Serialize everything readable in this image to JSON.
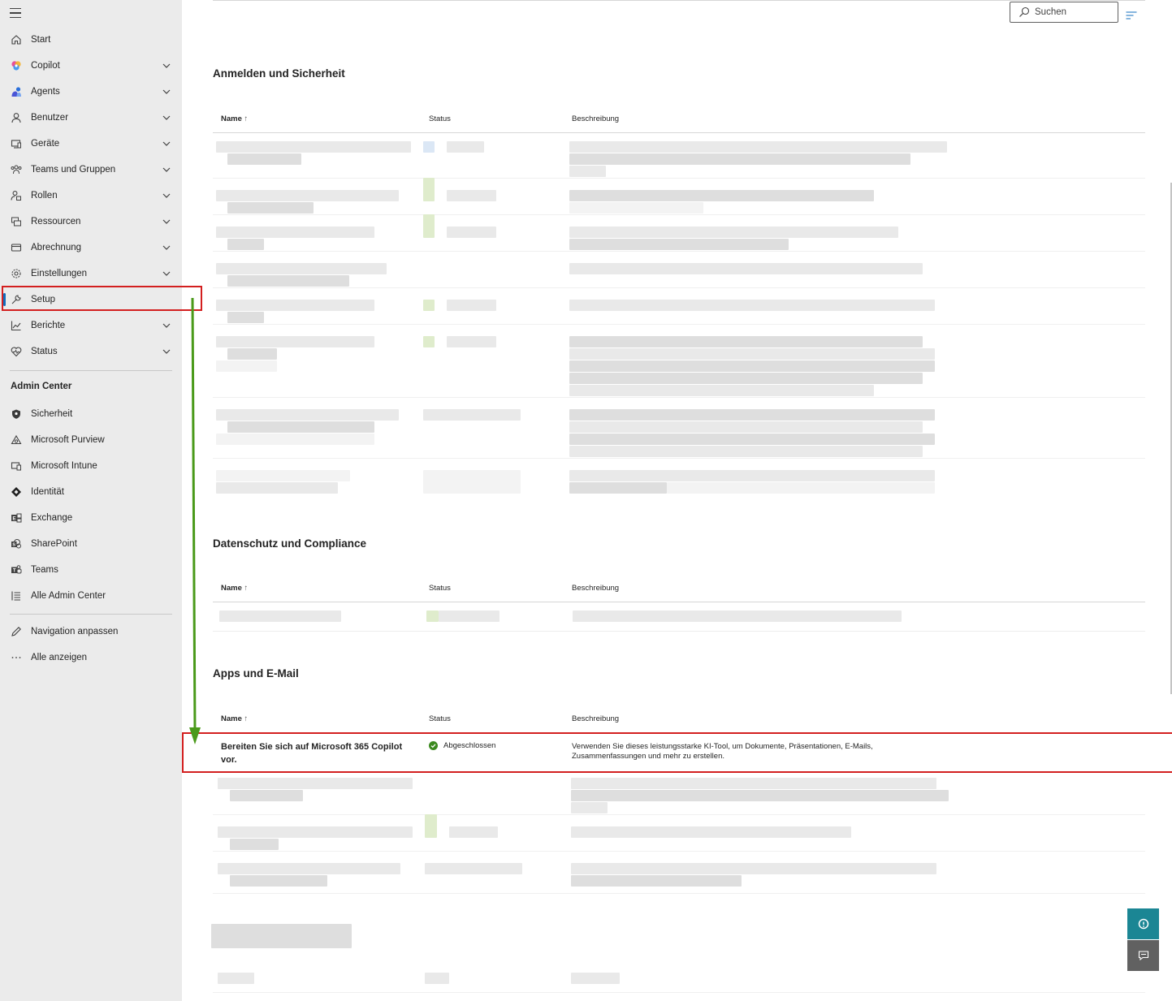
{
  "sidebar": {
    "items": [
      {
        "label": "Start",
        "icon": "home-icon",
        "chevron": false
      },
      {
        "label": "Copilot",
        "icon": "copilot-icon",
        "chevron": true
      },
      {
        "label": "Agents",
        "icon": "agents-icon",
        "chevron": true
      },
      {
        "label": "Benutzer",
        "icon": "user-icon",
        "chevron": true
      },
      {
        "label": "Geräte",
        "icon": "devices-icon",
        "chevron": true
      },
      {
        "label": "Teams und Gruppen",
        "icon": "teams-groups-icon",
        "chevron": true
      },
      {
        "label": "Rollen",
        "icon": "roles-icon",
        "chevron": true
      },
      {
        "label": "Ressourcen",
        "icon": "resources-icon",
        "chevron": true
      },
      {
        "label": "Abrechnung",
        "icon": "billing-icon",
        "chevron": true
      },
      {
        "label": "Einstellungen",
        "icon": "settings-icon",
        "chevron": true
      },
      {
        "label": "Setup",
        "icon": "wrench-icon",
        "chevron": false,
        "active": true
      },
      {
        "label": "Berichte",
        "icon": "reports-icon",
        "chevron": true
      },
      {
        "label": "Status",
        "icon": "health-icon",
        "chevron": true
      }
    ],
    "admin_center_label": "Admin Center",
    "admin_items": [
      {
        "label": "Sicherheit",
        "icon": "shield-icon"
      },
      {
        "label": "Microsoft Purview",
        "icon": "purview-icon"
      },
      {
        "label": "Microsoft Intune",
        "icon": "intune-icon"
      },
      {
        "label": "Identität",
        "icon": "identity-icon"
      },
      {
        "label": "Exchange",
        "icon": "exchange-icon"
      },
      {
        "label": "SharePoint",
        "icon": "sharepoint-icon"
      },
      {
        "label": "Teams",
        "icon": "teams-icon"
      },
      {
        "label": "Alle Admin Center",
        "icon": "all-admin-centers-icon"
      }
    ],
    "footer_items": [
      {
        "label": "Navigation anpassen",
        "icon": "pencil-icon"
      },
      {
        "label": "Alle anzeigen",
        "icon": "more-icon"
      }
    ]
  },
  "search": {
    "placeholder": "Suchen"
  },
  "columns": {
    "name": "Name",
    "sort": "↑",
    "status": "Status",
    "description": "Beschreibung"
  },
  "sections": [
    {
      "title": "Anmelden und Sicherheit"
    },
    {
      "title": "Datenschutz und Compliance"
    },
    {
      "title": "Apps und E-Mail"
    }
  ],
  "highlight_row": {
    "name": "Bereiten Sie sich auf Microsoft 365 Copilot vor.",
    "status": "Abgeschlossen",
    "description": "Verwenden Sie dieses leistungsstarke KI-Tool, um Dokumente, Präsentationen, E-Mails, Zusammenfassungen und mehr zu erstellen."
  },
  "colors": {
    "annotation_red": "#d31f1f",
    "annotation_arrow": "#4a9a1a",
    "active_accent": "#0f6cbd",
    "success_green": "#3b8a1f",
    "help_button": "#1b8694"
  }
}
